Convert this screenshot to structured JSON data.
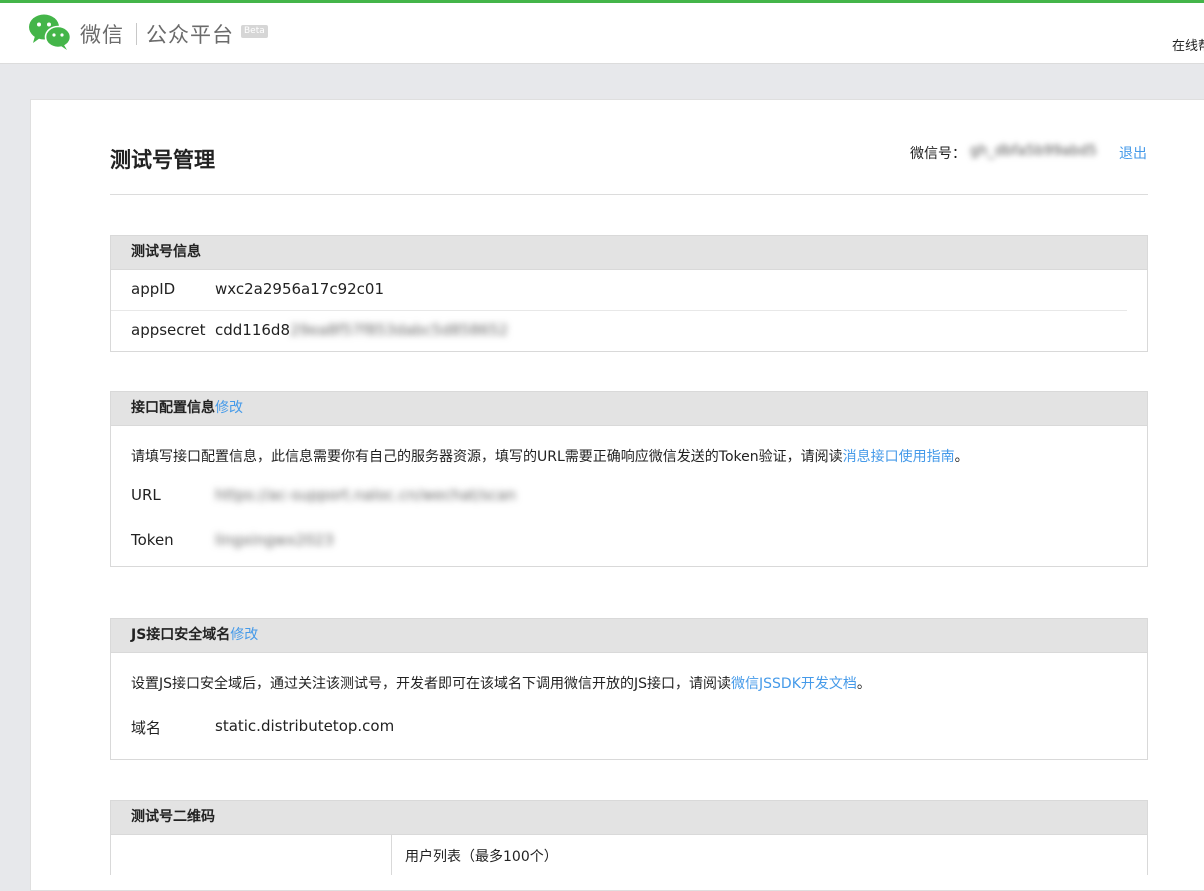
{
  "header": {
    "brand_wechat": "微信",
    "brand_platform": "公众平台",
    "beta": "Beta",
    "right_text": "在线帮助"
  },
  "page": {
    "title": "测试号管理",
    "account_label": "微信号：",
    "account_id": "gh_dbfa5b99abd5",
    "logout": "退出"
  },
  "test_info": {
    "heading": "测试号信息",
    "rows": [
      {
        "label": "appID",
        "value": "wxc2a2956a17c92c01"
      },
      {
        "label": "appsecret",
        "value_visible": "cdd116d8",
        "value_hidden": "29ea8f57f853dabc5d858652"
      }
    ]
  },
  "api_config": {
    "heading": "接口配置信息",
    "edit": "修改",
    "desc_prefix": "请填写接口配置信息，此信息需要你有自己的服务器资源，填写的URL需要正确响应微信发送的Token验证，请阅读",
    "desc_link": "消息接口使用指南",
    "desc_suffix": "。",
    "url_label": "URL",
    "url_value": "https://ac-support.naloc.cn/wechat/scan",
    "token_label": "Token",
    "token_value": "lingxingwx2023"
  },
  "js_domain": {
    "heading": "JS接口安全域名",
    "edit": "修改",
    "desc_prefix": "设置JS接口安全域后，通过关注该测试号，开发者即可在该域名下调用微信开放的JS接口，请阅读",
    "desc_link": "微信JSSDK开发文档",
    "desc_suffix": "。",
    "domain_label": "域名",
    "domain_value": "static.distributetop.com"
  },
  "qrcode": {
    "heading": "测试号二维码",
    "user_list": "用户列表（最多100个）"
  },
  "colors": {
    "accent_green": "#44b549",
    "link_blue": "#459ae9",
    "section_header_bg": "#e3e3e3"
  }
}
